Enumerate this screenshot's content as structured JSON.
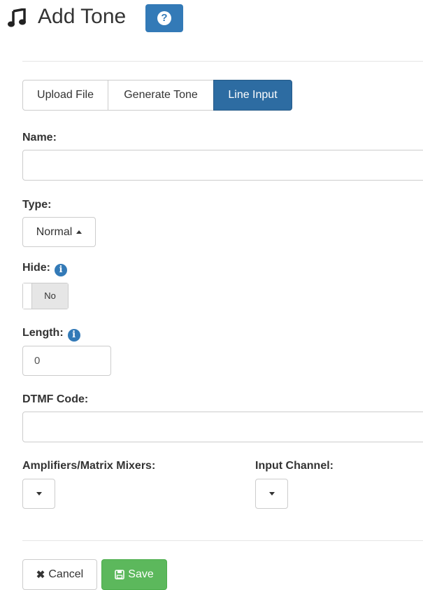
{
  "header": {
    "title": "Add Tone",
    "icon": "music-note-icon",
    "help_icon": "question-circle-icon",
    "help_label": "?",
    "accent_color": "#337ab7"
  },
  "tabs": [
    {
      "label": "Upload File",
      "active": false
    },
    {
      "label": "Generate Tone",
      "active": false
    },
    {
      "label": "Line Input",
      "active": true
    }
  ],
  "form": {
    "name": {
      "label": "Name:",
      "value": ""
    },
    "type": {
      "label": "Type:",
      "selected": "Normal"
    },
    "hide": {
      "label": "Hide:",
      "info_icon": "info-circle-icon",
      "info_glyph": "i",
      "state": "No"
    },
    "length": {
      "label": "Length:",
      "info_icon": "info-circle-icon",
      "info_glyph": "i",
      "value": "0"
    },
    "dtmf": {
      "label": "DTMF Code:",
      "value": ""
    },
    "amplifiers": {
      "label": "Amplifiers/Matrix Mixers:"
    },
    "input_channel": {
      "label": "Input Channel:"
    }
  },
  "footer": {
    "cancel_label": "Cancel",
    "cancel_icon": "times-icon",
    "save_label": "Save",
    "save_icon": "floppy-disk-icon",
    "save_color": "#5cb85c"
  }
}
